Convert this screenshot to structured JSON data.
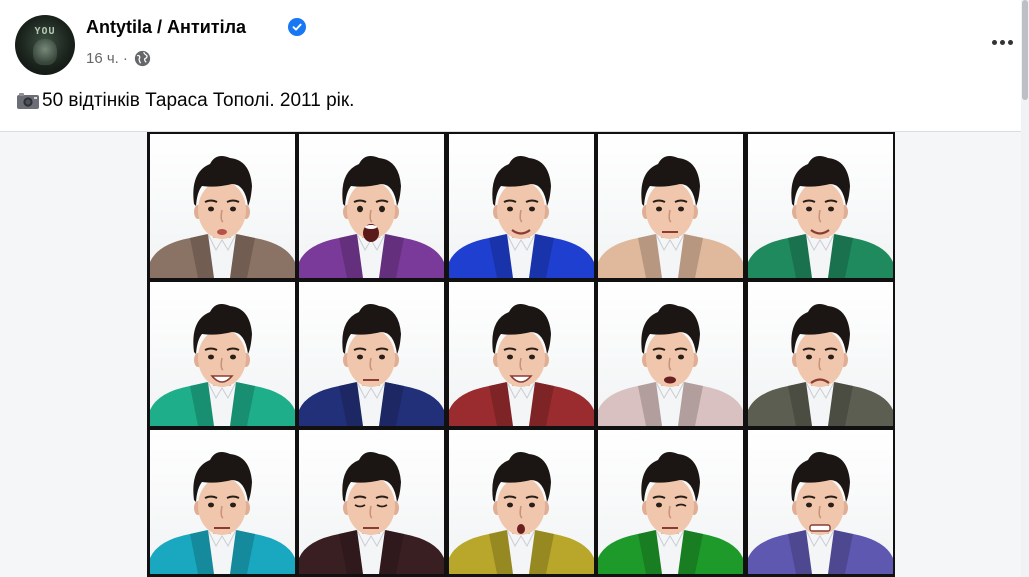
{
  "post": {
    "author": "Antytila / Антитіла",
    "timestamp": "16 ч.",
    "separator": "·",
    "privacy_icon": "globe-icon",
    "verified_icon": "verified-badge-icon",
    "more_icon": "more-horizontal-icon",
    "avatar_text": "YOU",
    "caption_icon": "camera-icon",
    "caption": "50 відтінків Тараса Тополі. 2011 рік."
  },
  "colors": {
    "verified_blue": "#1877f2",
    "text_secondary": "#65676b",
    "jackets": [
      "#8a7264",
      "#7a3a9a",
      "#1f3fd0",
      "#e0b89c",
      "#1f8a5e",
      "#1eae8a",
      "#22307a",
      "#9a2b2e",
      "#d8c1c0",
      "#5c5e52",
      "#1aa8c0",
      "#3a1f22",
      "#b8a72a",
      "#1e9a2a",
      "#5e58b0"
    ],
    "expressions": [
      "pout",
      "shout",
      "smile",
      "neutral",
      "smile",
      "grin",
      "neutral",
      "grin",
      "talk",
      "frown",
      "neutral",
      "eyes-closed",
      "ooh",
      "wink",
      "grimace"
    ]
  }
}
